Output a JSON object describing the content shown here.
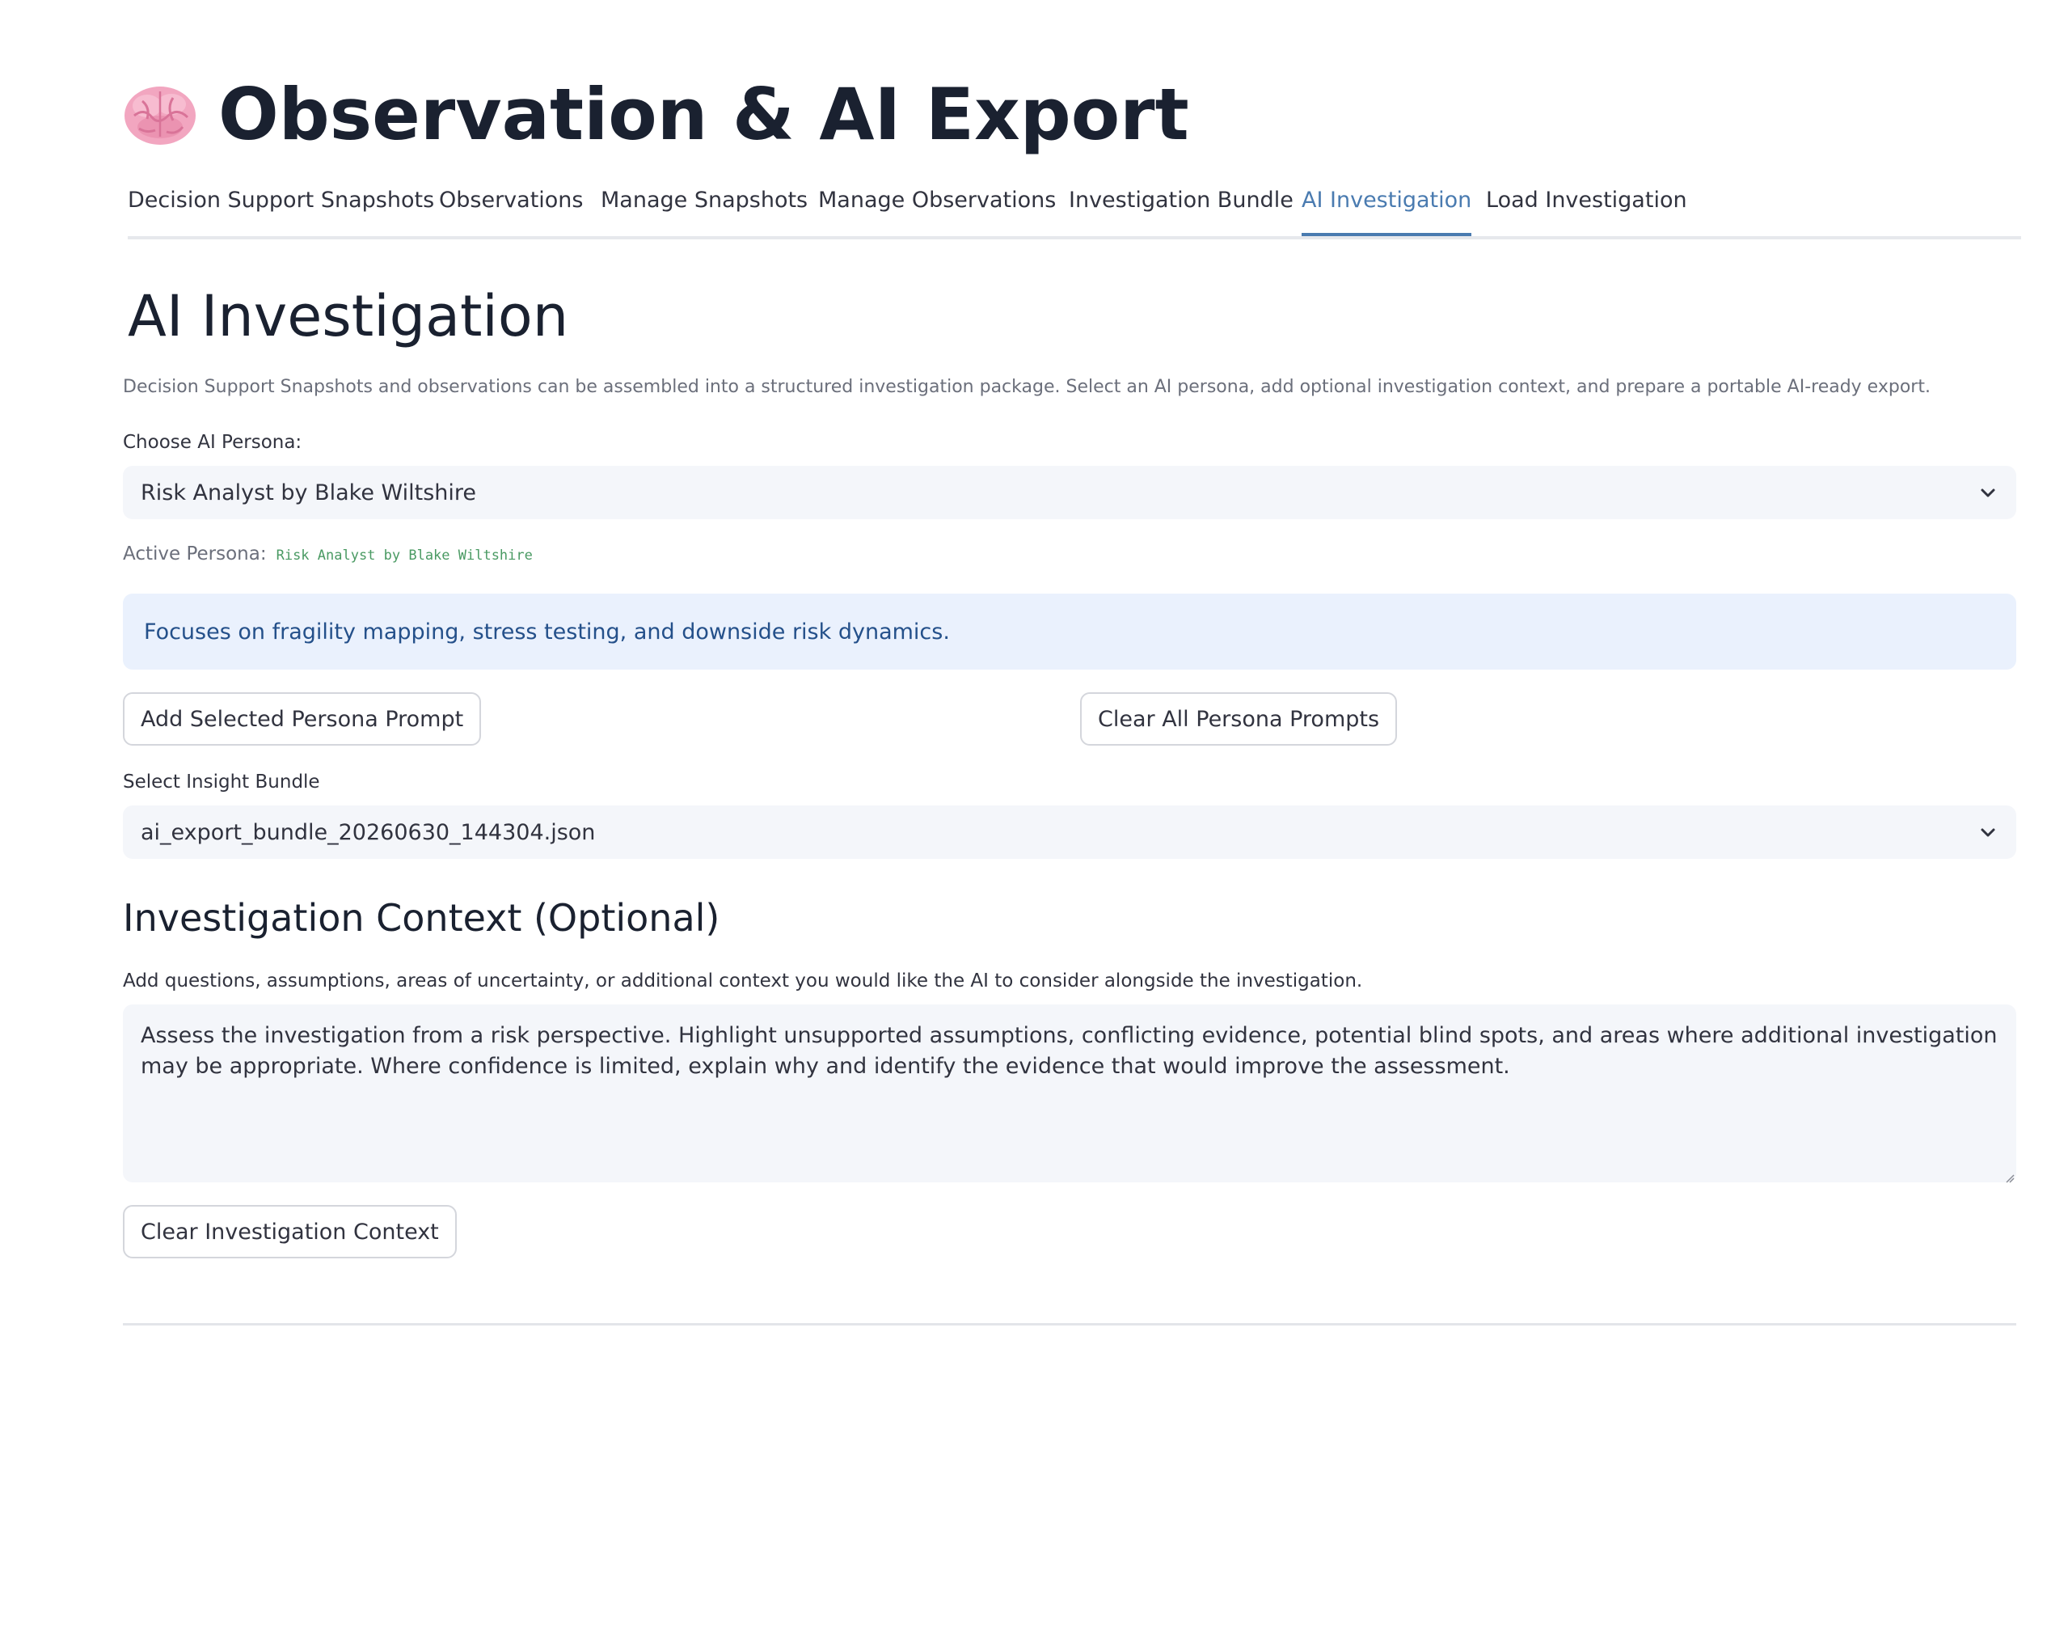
{
  "header": {
    "icon": "brain-icon",
    "title": "Observation & AI Export"
  },
  "tabs": [
    {
      "label": "Decision Support Snapshots",
      "active": false
    },
    {
      "label": "Observations",
      "active": false
    },
    {
      "label": "Manage Snapshots",
      "active": false
    },
    {
      "label": "Manage Observations",
      "active": false
    },
    {
      "label": "Investigation Bundle",
      "active": false
    },
    {
      "label": "AI Investigation",
      "active": true
    },
    {
      "label": "Load Investigation",
      "active": false
    }
  ],
  "main": {
    "title": "AI Investigation",
    "description": "Decision Support Snapshots and observations can be assembled into a structured investigation package. Select an AI persona, add optional investigation context, and prepare a portable AI-ready export.",
    "persona": {
      "label": "Choose AI Persona:",
      "selected": "Risk Analyst by Blake Wiltshire",
      "active_label": "Active Persona:",
      "active_value": "Risk Analyst by Blake Wiltshire",
      "info": "Focuses on fragility mapping, stress testing, and downside risk dynamics.",
      "add_button": "Add Selected Persona Prompt",
      "clear_button": "Clear All Persona Prompts"
    },
    "bundle": {
      "label": "Select Insight Bundle",
      "selected": "ai_export_bundle_20260630_144304.json"
    },
    "context": {
      "heading": "Investigation Context (Optional)",
      "help": "Add questions, assumptions, areas of uncertainty, or additional context you would like the AI to consider alongside the investigation.",
      "value": "Assess the investigation from a risk perspective. Highlight unsupported assumptions, conflicting evidence, potential blind spots, and areas where additional investigation may be appropriate. Where confidence is limited, explain why and identify the evidence that would improve the assessment.",
      "clear_button": "Clear Investigation Context"
    }
  },
  "colors": {
    "accent": "#4a7bb0",
    "info_bg": "#eaf1fd",
    "info_text": "#24508a",
    "field_bg": "#f4f6fa",
    "persona_code": "#4a9a63"
  }
}
